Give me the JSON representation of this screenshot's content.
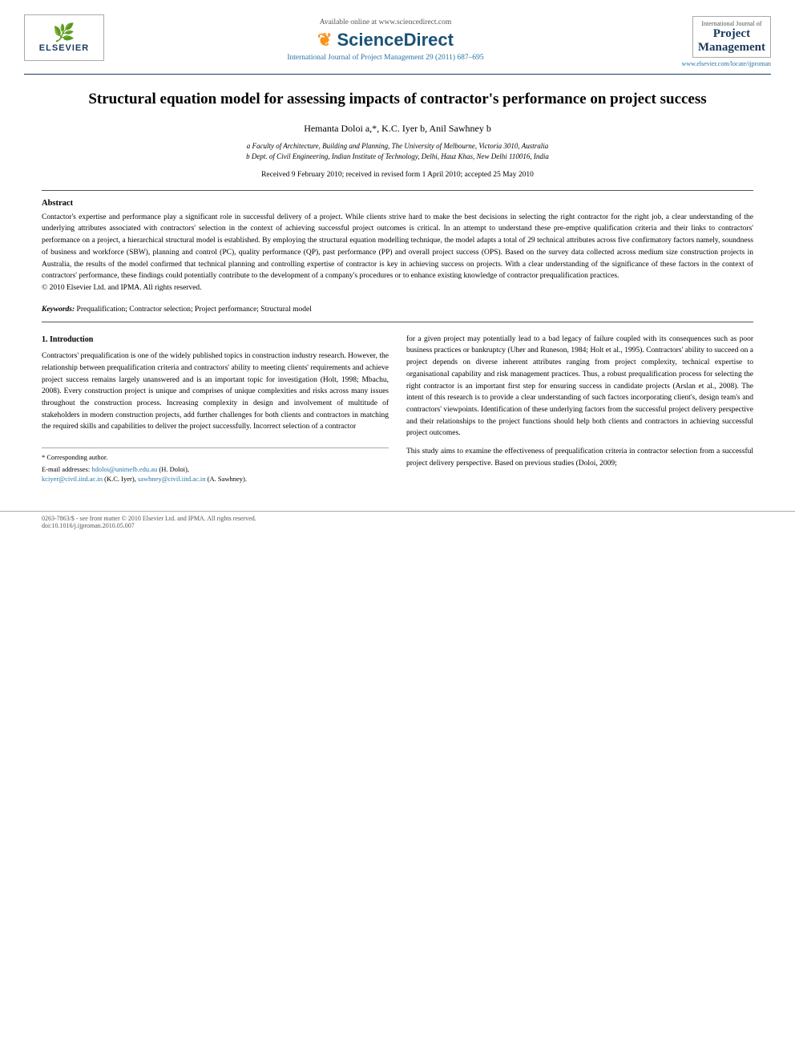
{
  "header": {
    "available_online": "Available online at www.sciencedirect.com",
    "sd_icon": "❧",
    "sd_name": "ScienceDirect",
    "journal_ref": "International Journal of Project Management 29 (2011) 687–695",
    "journal_intl": "International Journal of",
    "journal_main_line1": "Project",
    "journal_main_line2": "Management",
    "journal_url": "www.elsevier.com/locate/ijproman"
  },
  "paper": {
    "title": "Structural equation model for assessing impacts of contractor's performance on project success",
    "authors": "Hemanta Doloi a,*, K.C. Iyer b, Anil Sawhney b",
    "affil_a": "a Faculty of Architecture, Building and Planning, The University of Melbourne, Victoria 3010, Australia",
    "affil_b": "b Dept. of Civil Engineering, Indian Institute of Technology, Delhi, Hauz Khas, New Delhi 110016, India",
    "received": "Received 9 February 2010; received in revised form 1 April 2010; accepted 25 May 2010"
  },
  "abstract": {
    "label": "Abstract",
    "text": "Contactor's expertise and performance play a significant role in successful delivery of a project. While clients strive hard to make the best decisions in selecting the right contractor for the right job, a clear understanding of the underlying attributes associated with contractors' selection in the context of achieving successful project outcomes is critical. In an attempt to understand these pre-emptive qualification criteria and their links to contractors' performance on a project, a hierarchical structural model is established. By employing the structural equation modelling technique, the model adapts a total of 29 technical attributes across five confirmatory factors namely, soundness of business and workforce (SBW), planning and control (PC), quality performance (QP), past performance (PP) and overall project success (OPS). Based on the survey data collected across medium size construction projects in Australia, the results of the model confirmed that technical planning and controlling expertise of contractor is key in achieving success on projects. With a clear understanding of the significance of these factors in the context of contractors' performance, these findings could potentially contribute to the development of a company's procedures or to enhance existing knowledge of contractor prequalification practices.",
    "copyright": "© 2010 Elsevier Ltd. and IPMA. All rights reserved.",
    "keywords_label": "Keywords:",
    "keywords": "Prequalification; Contractor selection; Project performance; Structural model"
  },
  "section1": {
    "heading": "1.  Introduction",
    "col_left": {
      "para1": "Contractors' prequalification is one of the widely published topics in construction industry research. However, the relationship between prequalification criteria and contractors' ability to meeting clients' requirements and achieve project success remains largely unanswered and is an important topic for investigation (Holt, 1998; Mbachu, 2008). Every construction project is unique and comprises of unique complexities and risks across many issues throughout the construction process. Increasing complexity in design and involvement of multitude of stakeholders in modern construction projects, add further challenges for both clients and contractors in matching the required skills and capabilities to deliver the project successfully. Incorrect selection of a contractor"
    },
    "col_right": {
      "para1": "for a given project may potentially lead to a bad legacy of failure coupled with its consequences such as poor business practices or bankruptcy (Uher and Runeson, 1984; Holt et al., 1995). Contractors' ability to succeed on a project depends on diverse inherent attributes ranging from project complexity, technical expertise to organisational capability and risk management practices. Thus, a robust prequalification process for selecting the right contractor is an important first step for ensuring success in candidate projects (Arslan et al., 2008). The intent of this research is to provide a clear understanding of such factors incorporating client's, design team's and contractors' viewpoints. Identification of these underlying factors from the successful project delivery perspective and their relationships to the project functions should help both clients and contractors in achieving successful project outcomes.",
      "para2": "This study aims to examine the effectiveness of prequalification criteria in contractor selection from a successful project delivery perspective. Based on previous studies (Doloi, 2009;"
    }
  },
  "footnotes": {
    "corresponding": "* Corresponding author.",
    "email_label": "E-mail addresses:",
    "email1": "hdoloi@unimelb.edu.au",
    "email1_name": "(H. Doloi),",
    "email2": "kciyer@civil.iitd.ac.in",
    "email2_name": "(K.C. Iyer),",
    "email3": "sawhney@civil.iitd.ac.in",
    "email3_name": "(A. Sawhney)."
  },
  "footer": {
    "issn": "0263-7863/$ - see front matter © 2010 Elsevier Ltd. and IPMA. All rights reserved.",
    "doi": "doi:10.1016/j.ijproman.2010.05.007"
  }
}
